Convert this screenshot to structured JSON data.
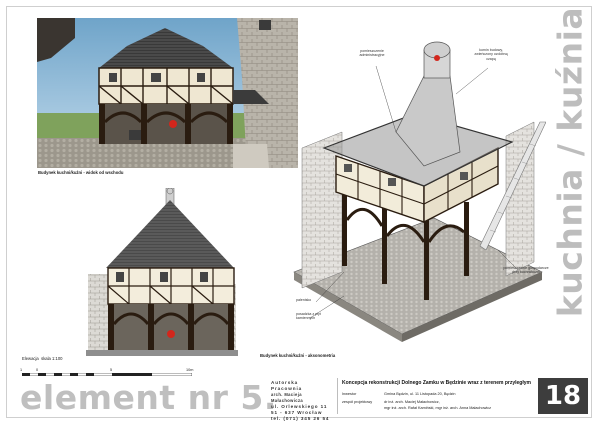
{
  "vertical_title": "kuchnia / kuźnia",
  "captions": {
    "view_east": "Budynek kuchni/kuźni - widok od wschodu",
    "axonometry": "Budynek kuchni/kuźni - aksonometria",
    "elevation_label": "Elewacja",
    "elevation_scale": "skala 1:100"
  },
  "scale_bar": {
    "ticks": [
      "1",
      "0",
      "5",
      "10m"
    ]
  },
  "annotations": {
    "admin_room": "pomieszczenie administracyjne",
    "chimney": "komin budowy, zwieńczony ozdobną czapą",
    "storage": "pomieszczenie gospodarcze przy kuchni/kuźni",
    "hearth": "palenisko",
    "floor": "posadzka z płyt kamiennych"
  },
  "element_label": "element nr 5.",
  "sheet_number": "18",
  "authors": {
    "line1": "Autorska Pracownia",
    "line2": "arch. Macieja Małachowicza",
    "line3": "ul. Orlewskiego 11",
    "line4": "51 - 637 Wrocław",
    "line5": "tel. (071) 345 26 54"
  },
  "project_title": "Koncepcja rekonstrukcji Dolnego Zamku w Będzinie wraz z terenem przyległym",
  "investor": {
    "label": "Inwestor",
    "value": "Gmina Będzin, ul. 11 Listopada 20, Będzin"
  },
  "team": {
    "label": "zespół projektowy",
    "line1": "dr inż. arch. Maciej Małachowicz,",
    "line2": "mgr inż. arch. Rafał Kamiński, mgr inż. arch. Anna Małachowicz"
  },
  "colors": {
    "title_gray": "#bfbfbf",
    "sheet_box": "#3d3d3d",
    "fire": "#d3261c"
  }
}
